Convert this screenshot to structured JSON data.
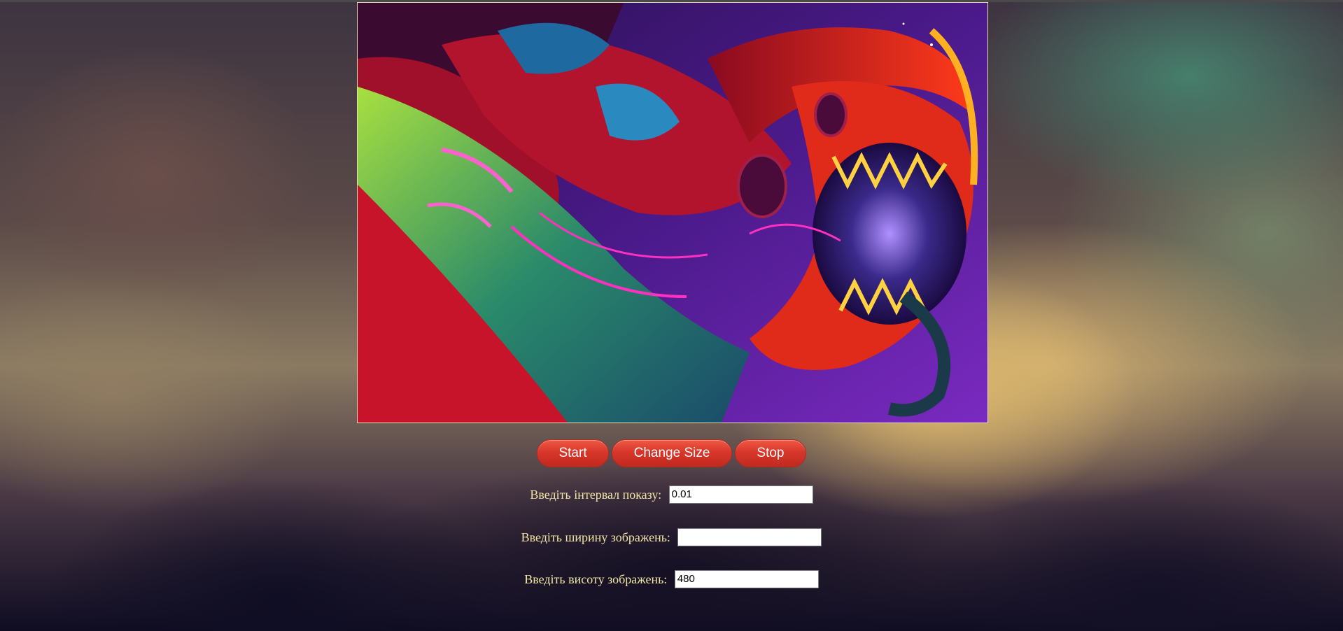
{
  "controls": {
    "start_label": "Start",
    "change_size_label": "Change Size",
    "stop_label": "Stop"
  },
  "form": {
    "interval": {
      "label": "Введіть інтервал показу:",
      "value": "0.01"
    },
    "width": {
      "label": "Введіть ширину зображень:",
      "value": ""
    },
    "height": {
      "label": "Введіть висоту зображень:",
      "value": "480"
    }
  },
  "colors": {
    "label_text": "#f1e6a6",
    "button_red": "#d8362a",
    "frame_border": "#e7dfb6"
  },
  "slideshow": {
    "image_subject": "colorful-dragon-artwork"
  }
}
